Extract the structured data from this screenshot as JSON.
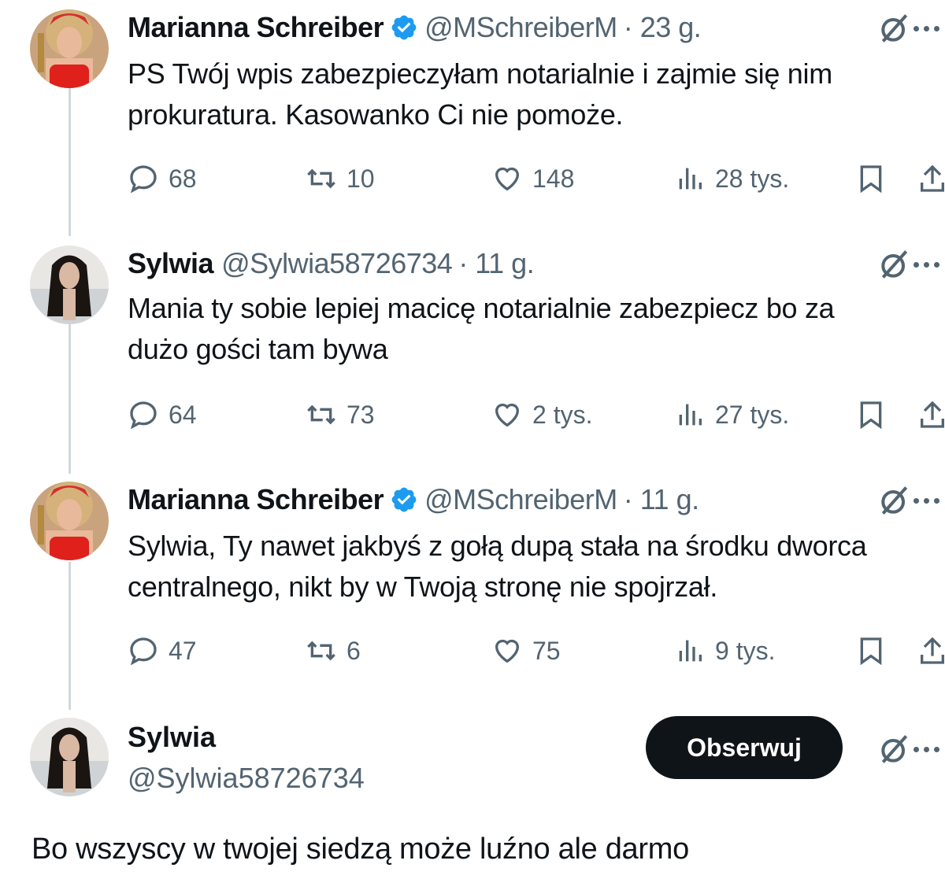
{
  "icons": {
    "reply": "reply-icon",
    "retweet": "retweet-icon",
    "like": "heart-icon",
    "views": "views-icon",
    "bookmark": "bookmark-icon",
    "share": "share-icon",
    "grok": "grok-icon",
    "more": "more-icon",
    "verified": "verified-badge-icon"
  },
  "colors": {
    "verified": "#1d9bf0",
    "follow_bg": "#0f1419",
    "muted": "#536471"
  },
  "tweets": [
    {
      "name": "Marianna Schreiber",
      "handle": "@MSchreiberM",
      "time": "· 23 g.",
      "verified": true,
      "text_line1": "PS Twój wpis zabezpieczyłam notarialnie i zajmie się nim",
      "text_line2": "prokuratura. Kasowanko Ci nie pomoże.",
      "replies": "68",
      "retweets": "10",
      "likes": "148",
      "views": "28 tys."
    },
    {
      "name": "Sylwia",
      "handle": "@Sylwia58726734",
      "time": "· 11 g.",
      "verified": false,
      "text_line1": "Mania ty sobie lepiej macicę notarialnie zabezpiecz bo za",
      "text_line2": "dużo gości tam bywa",
      "replies": "64",
      "retweets": "73",
      "likes": "2 tys.",
      "views": "27 tys."
    },
    {
      "name": "Marianna Schreiber",
      "handle": "@MSchreiberM",
      "time": "· 11 g.",
      "verified": true,
      "text_line1": "Sylwia, Ty nawet jakbyś z gołą dupą stała na środku dworca",
      "text_line2": "centralnego, nikt by w Twoją stronę nie spojrzał.",
      "replies": "47",
      "retweets": "6",
      "likes": "75",
      "views": "9 tys."
    }
  ],
  "final_tweet": {
    "name": "Sylwia",
    "handle": "@Sylwia58726734",
    "follow_label": "Obserwuj",
    "text": "Bo wszyscy w twojej siedzą może luźno ale darmo"
  }
}
